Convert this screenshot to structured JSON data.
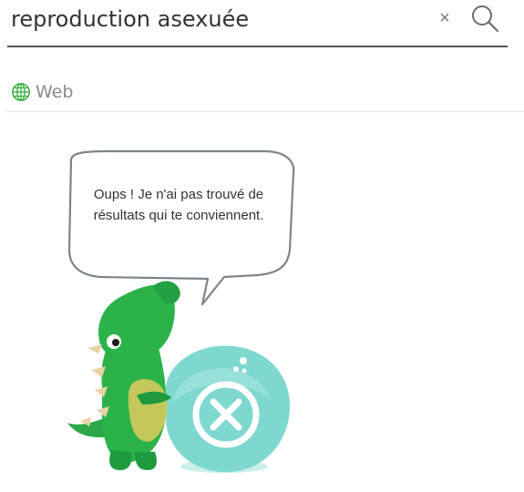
{
  "search": {
    "query": "reproduction asexuée",
    "clear_icon": "×"
  },
  "tabs": [
    {
      "label": "Web",
      "icon": "globe-icon"
    }
  ],
  "empty_state": {
    "message": "Oups ! Je n'ai pas trouvé de résultats qui te conviennent.",
    "colors": {
      "accent_green": "#2bb34a",
      "circle_teal": "#7fd8cf"
    }
  }
}
